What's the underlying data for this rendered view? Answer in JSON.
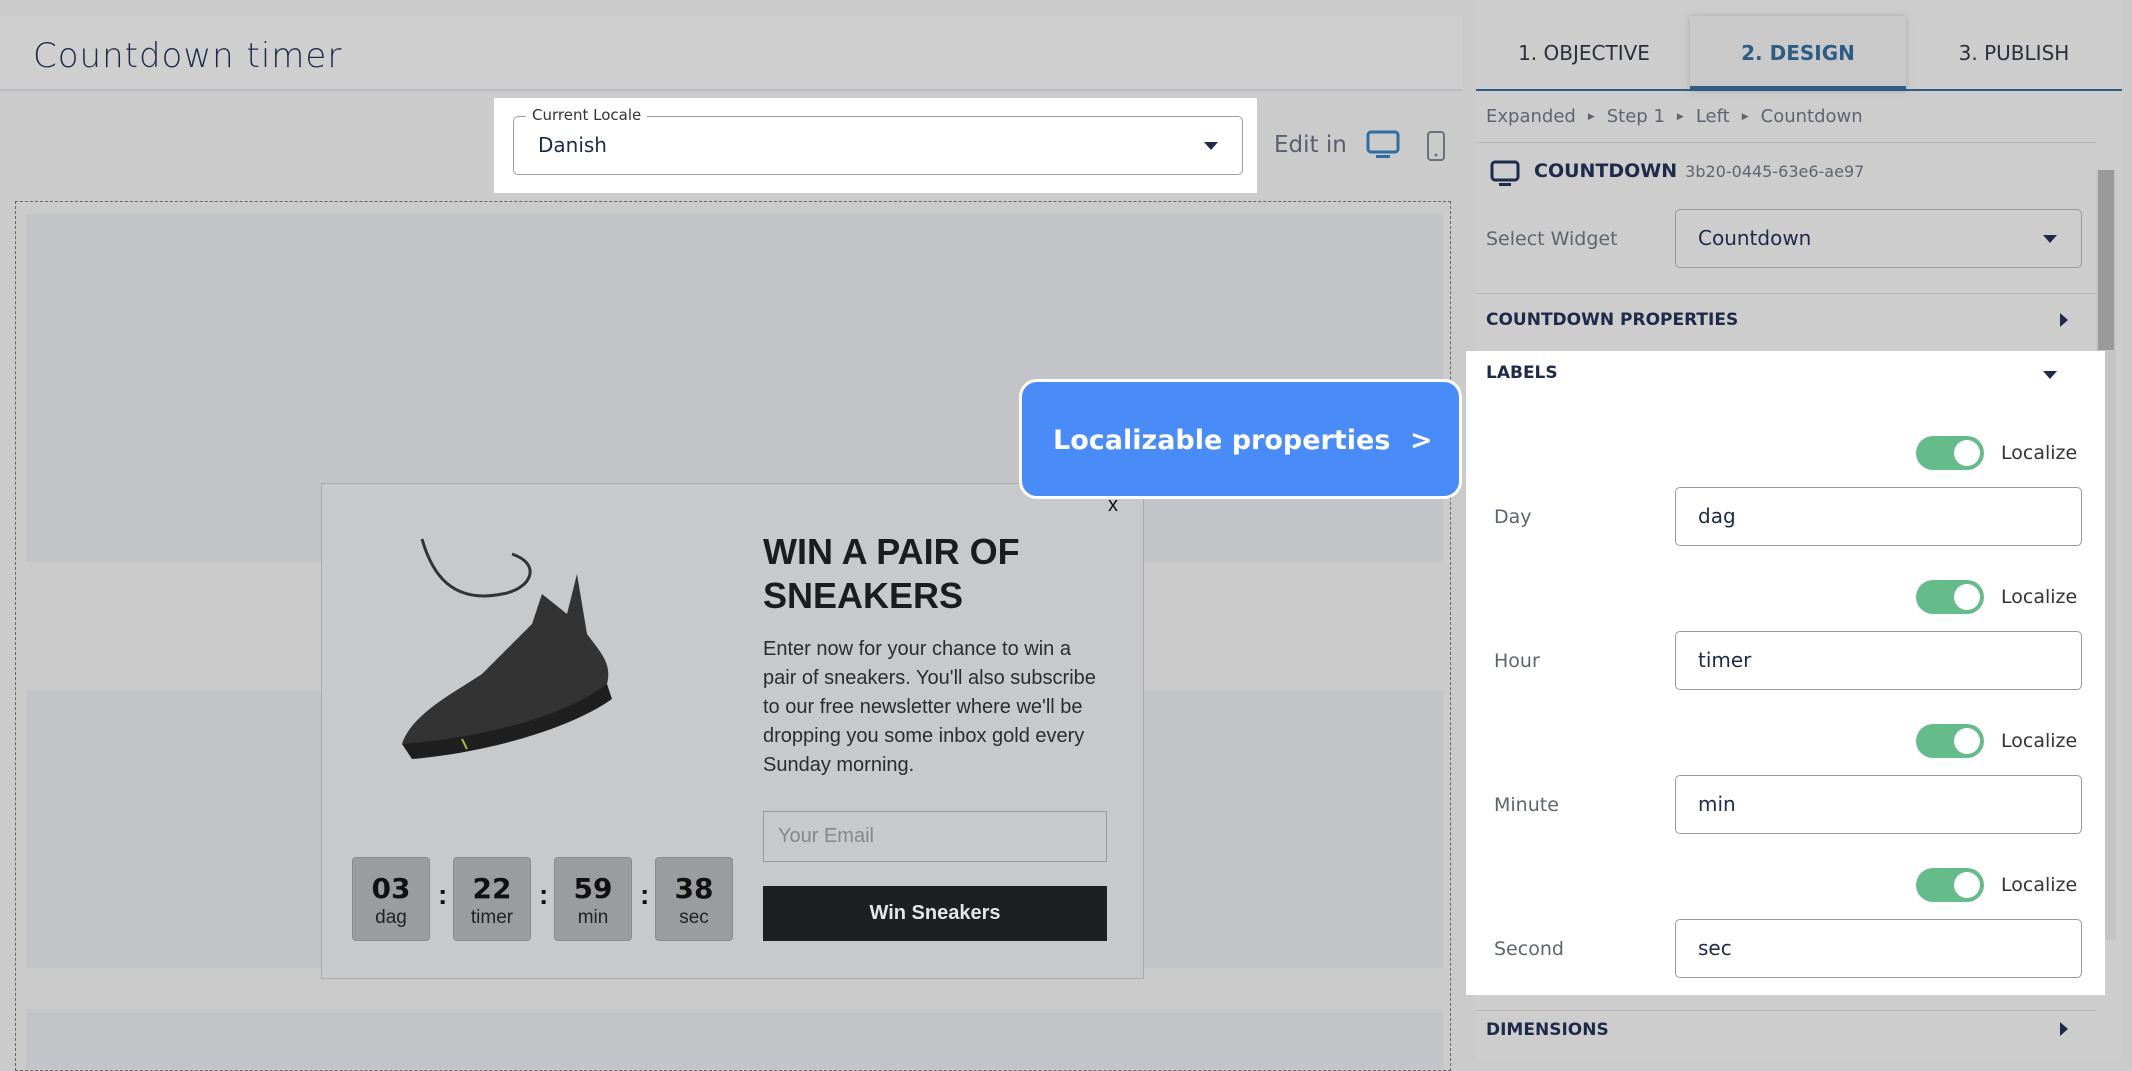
{
  "header": {
    "title": "Countdown timer"
  },
  "locale": {
    "label": "Current Locale",
    "value": "Danish"
  },
  "edit_in": {
    "label": "Edit in",
    "icons": [
      "desktop-icon",
      "mobile-icon"
    ]
  },
  "popup": {
    "title": "WIN A PAIR OF SNEAKERS",
    "body": "Enter now for your chance to win a pair of sneakers. You'll also subscribe to our free newsletter where we'll be dropping you some inbox gold every Sunday morning.",
    "email_placeholder": "Your Email",
    "button": "Win Sneakers",
    "close": "x",
    "countdown": [
      {
        "value": "03",
        "label": "dag"
      },
      {
        "value": "22",
        "label": "timer"
      },
      {
        "value": "59",
        "label": "min"
      },
      {
        "value": "38",
        "label": "sec"
      }
    ],
    "separator": ":"
  },
  "callout": {
    "label": "Localizable properties",
    "arrow": ">",
    "color": "#4a8cf7"
  },
  "panel": {
    "tabs": [
      {
        "label": "1. OBJECTIVE"
      },
      {
        "label": "2. DESIGN",
        "active": true
      },
      {
        "label": "3. PUBLISH"
      }
    ],
    "breadcrumb": [
      "Expanded",
      "Step 1",
      "Left",
      "Countdown"
    ],
    "widget": {
      "type": "COUNTDOWN",
      "id": "3b20-0445-63e6-ae97"
    },
    "select_widget": {
      "label": "Select Widget",
      "value": "Countdown"
    },
    "sections": {
      "countdown_properties": "COUNTDOWN PROPERTIES",
      "labels": "LABELS",
      "dimensions": "DIMENSIONS"
    },
    "labels": [
      {
        "name": "Day",
        "value": "dag",
        "localize": "Localize",
        "on": true
      },
      {
        "name": "Hour",
        "value": "timer",
        "localize": "Localize",
        "on": true
      },
      {
        "name": "Minute",
        "value": "min",
        "localize": "Localize",
        "on": true
      },
      {
        "name": "Second",
        "value": "sec",
        "localize": "Localize",
        "on": true
      }
    ]
  }
}
